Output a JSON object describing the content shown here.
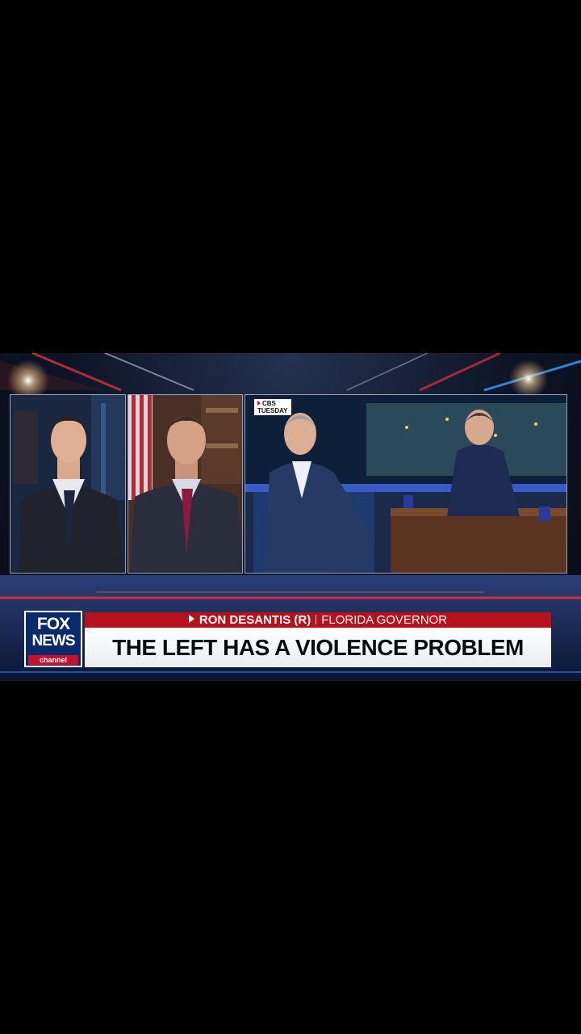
{
  "panels": {
    "right": {
      "source_tag": {
        "line1": "CBS",
        "line2": "TUESDAY"
      }
    }
  },
  "lower_third": {
    "logo": {
      "line1": "FOX",
      "line2": "NEWS",
      "line3": "channel"
    },
    "name": "RON DESANTIS (R)",
    "title": "FLORIDA GOVERNOR",
    "headline": "THE LEFT HAS A VIOLENCE PROBLEM"
  },
  "colors": {
    "brand_red": "#b5121b",
    "logo_blue": "#0c2a6b",
    "background": "#000000"
  }
}
